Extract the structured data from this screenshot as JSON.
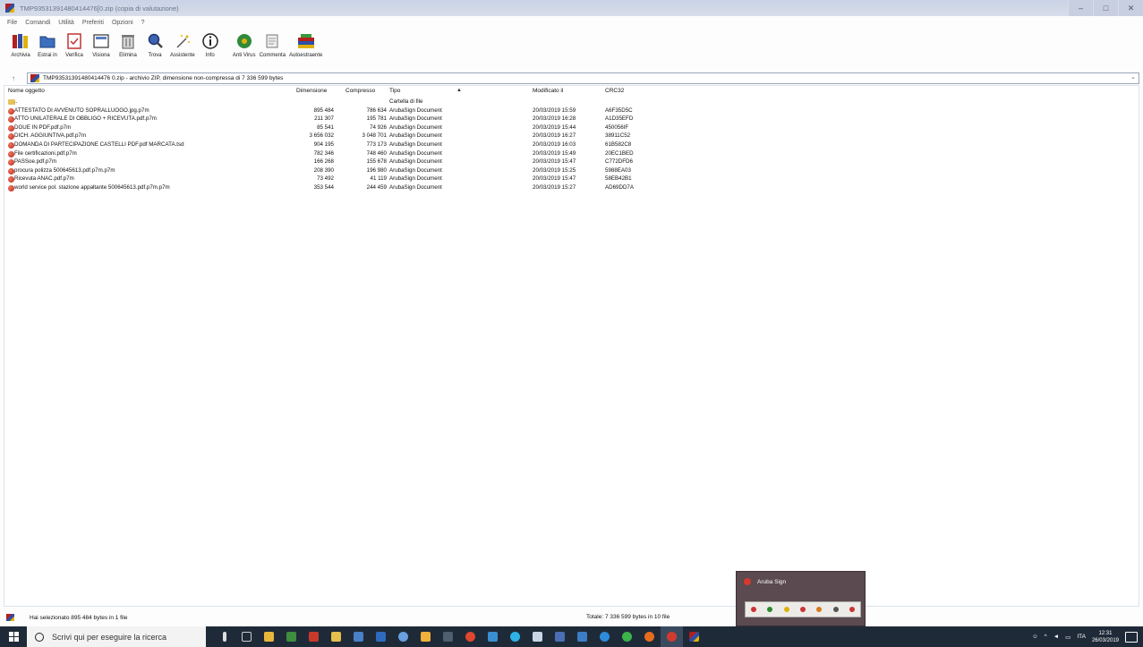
{
  "window": {
    "title": "TMP93531391480414476[0.zip (copia di valutazione)",
    "buttons": [
      "–",
      "□",
      "✕"
    ]
  },
  "menu": [
    "File",
    "Comandi",
    "Utilità",
    "Preferiti",
    "Opzioni",
    "?"
  ],
  "toolbar": [
    {
      "label": "Archivia",
      "icon": "archive-books-icon"
    },
    {
      "label": "Estrai in",
      "icon": "extract-folder-icon"
    },
    {
      "label": "Verifica",
      "icon": "test-icon"
    },
    {
      "label": "Visiona",
      "icon": "view-icon"
    },
    {
      "label": "Elimina",
      "icon": "trash-icon"
    },
    {
      "label": "Trova",
      "icon": "magnifier-icon"
    },
    {
      "label": "Assistente",
      "icon": "wizard-icon"
    },
    {
      "label": "Info",
      "icon": "info-icon"
    },
    {
      "label": "Anti Virus",
      "icon": "antivirus-icon"
    },
    {
      "label": "Commenta",
      "icon": "comment-icon"
    },
    {
      "label": "Autoestraente",
      "icon": "sfx-icon"
    }
  ],
  "address": {
    "up": "↑",
    "path": "TMP93531391480414476 0.zip - archivio ZIP, dimensione non-compressa di 7 336 599 bytes"
  },
  "columns": {
    "name": "Nome oggetto",
    "size": "Dimensione",
    "packed": "Compresso",
    "type": "Tipo",
    "modified": "Modificato il",
    "crc": "CRC32"
  },
  "rows": [
    {
      "name": "..",
      "size": "",
      "packed": "",
      "type": "Cartella di file",
      "modified": "",
      "crc": "",
      "kind": "folder"
    },
    {
      "name": "ATTESTATO DI AVVENUTO SOPRALLUOGO.jpg.p7m",
      "size": "895 484",
      "packed": "786 634",
      "type": "ArubaSign Document",
      "modified": "20/03/2019 15:59",
      "crc": "A6F35D5C",
      "kind": "file"
    },
    {
      "name": "ATTO UNILATERALE DI OBBLIGO + RICEVUTA.pdf.p7m",
      "size": "211 307",
      "packed": "195 781",
      "type": "ArubaSign Document",
      "modified": "20/03/2019 16:28",
      "crc": "A1D35EFD",
      "kind": "file"
    },
    {
      "name": "DGUE IN PDF.pdf.p7m",
      "size": "85 541",
      "packed": "74 926",
      "type": "ArubaSign Document",
      "modified": "20/03/2019 15:44",
      "crc": "450056IF",
      "kind": "file"
    },
    {
      "name": "DICH. AGGIUNTIVA.pdf.p7m",
      "size": "3 656 032",
      "packed": "3 048 701",
      "type": "ArubaSign Document",
      "modified": "20/03/2019 16:27",
      "crc": "38911C52",
      "kind": "file"
    },
    {
      "name": "DOMANDA DI PARTECIPAZIONE CASTELLI PDF.pdf MARCATA.tsd",
      "size": "904 195",
      "packed": "773 173",
      "type": "ArubaSign Document",
      "modified": "20/03/2019 16:03",
      "crc": "61B582C8",
      "kind": "file"
    },
    {
      "name": "File certificazioni.pdf.p7m",
      "size": "782 346",
      "packed": "748 460",
      "type": "ArubaSign Document",
      "modified": "20/03/2019 15:49",
      "crc": "20EC1BED",
      "kind": "file"
    },
    {
      "name": "PASSoe.pdf.p7m",
      "size": "166 268",
      "packed": "155 678",
      "type": "ArubaSign Document",
      "modified": "20/03/2019 15:47",
      "crc": "C772DFD6",
      "kind": "file"
    },
    {
      "name": "procura polizza 500645613.pdf.p7m.p7m",
      "size": "208 390",
      "packed": "196 980",
      "type": "ArubaSign Document",
      "modified": "20/03/2019 15:25",
      "crc": "5988EA03",
      "kind": "file"
    },
    {
      "name": "Ricevuta ANAC.pdf.p7m",
      "size": "73 492",
      "packed": "41 119",
      "type": "ArubaSign Document",
      "modified": "20/03/2019 15:47",
      "crc": "58EB42B1",
      "kind": "file"
    },
    {
      "name": "world service pol. stazione appaltante 500645613.pdf.p7m.p7m",
      "size": "353 544",
      "packed": "244 459",
      "type": "ArubaSign Document",
      "modified": "20/03/2019 15:27",
      "crc": "AD69DD7A",
      "kind": "file"
    }
  ],
  "status": {
    "selected": "Hai selezionato 895 484 bytes in 1 file",
    "total": "Totale: 7 336 599 bytes in 10 file"
  },
  "aruba_popup": {
    "title": "Aruba Sign"
  },
  "taskbar": {
    "search_placeholder": "Scrivi qui per eseguire la ricerca",
    "lang": "ITA",
    "time": "12:31",
    "date": "26/03/2019"
  }
}
